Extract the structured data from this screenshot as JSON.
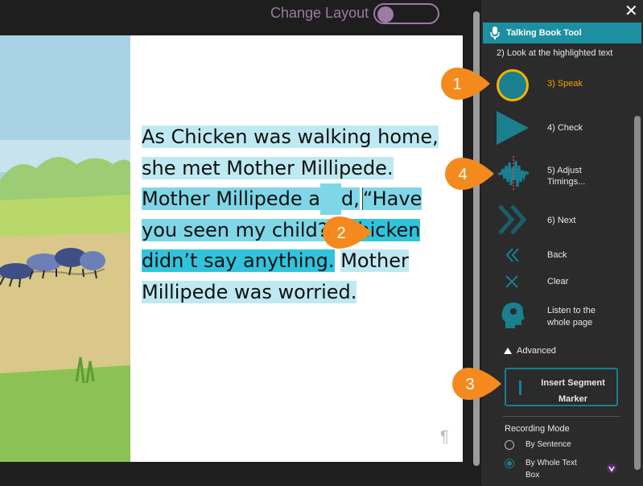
{
  "header": {
    "change_layout_label": "Change Layout"
  },
  "book": {
    "segments": [
      {
        "text": "As Chicken was walking home,",
        "style": "light"
      },
      {
        "text": "she met Mother Millipede.",
        "style": "light"
      },
      {
        "text": "Mother Millipede a",
        "style": "med"
      },
      {
        "text": "d,",
        "style": "med"
      },
      {
        "text": "“Have",
        "style": "med"
      },
      {
        "text": "you seen my child?”",
        "style": "med"
      },
      {
        "text": "Chicken",
        "style": "dark"
      },
      {
        "text": "didn’t say anything.",
        "style": "dark"
      },
      {
        "text": "Mother",
        "style": "light"
      },
      {
        "text": "Millipede was worried.",
        "style": "light"
      }
    ],
    "pilcrow": "¶"
  },
  "panel": {
    "close_label": "✕",
    "title": "Talking Book Tool",
    "step2": "2) Look at the highlighted text",
    "steps": {
      "speak": "3) Speak",
      "check": "4) Check",
      "adjust_line1": "5) Adjust",
      "adjust_line2": "Timings...",
      "next": "6) Next",
      "back": "Back",
      "clear": "Clear",
      "listen_line1": "Listen to the",
      "listen_line2": "whole page"
    },
    "advanced": "Advanced",
    "insert_line1": "Insert Segment",
    "insert_line2": "Marker",
    "recording_mode": "Recording Mode",
    "by_sentence": "By Sentence",
    "by_whole_line1": "By Whole Text",
    "by_whole_line2": "Box",
    "selected_mode": "By Whole Text Box"
  },
  "callouts": [
    "1",
    "2",
    "3",
    "4"
  ],
  "colors": {
    "accent": "#1a7f8f",
    "callout": "#f48a1e",
    "speak_ring": "#f4b400",
    "layout_purple": "#9b7aa3"
  }
}
